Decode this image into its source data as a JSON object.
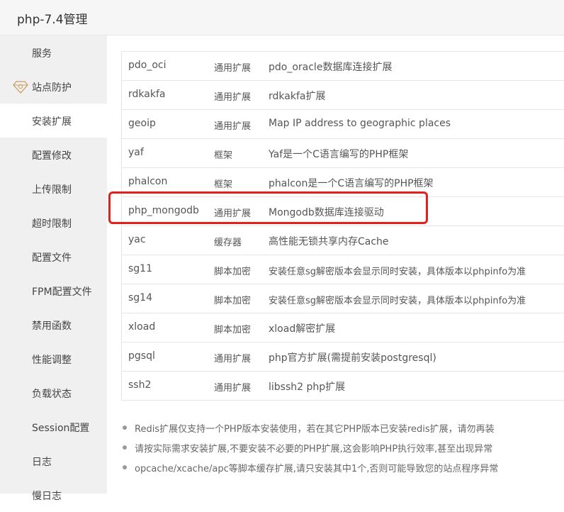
{
  "window": {
    "title": "php-7.4管理"
  },
  "sidebar": {
    "items": [
      {
        "label": "服务"
      },
      {
        "label": "站点防护",
        "icon": "gem-icon"
      },
      {
        "label": "安装扩展",
        "active": true
      },
      {
        "label": "配置修改"
      },
      {
        "label": "上传限制"
      },
      {
        "label": "超时限制"
      },
      {
        "label": "配置文件"
      },
      {
        "label": "FPM配置文件"
      },
      {
        "label": "禁用函数"
      },
      {
        "label": "性能调整"
      },
      {
        "label": "负载状态"
      },
      {
        "label": "Session配置"
      },
      {
        "label": "日志"
      },
      {
        "label": "慢日志"
      }
    ]
  },
  "extensions": {
    "rows": [
      {
        "name": "pdo_oci",
        "type": "通用扩展",
        "desc": "pdo_oracle数据库连接扩展"
      },
      {
        "name": "rdkakfa",
        "type": "通用扩展",
        "desc": "rdkakfa扩展"
      },
      {
        "name": "geoip",
        "type": "通用扩展",
        "desc": "Map IP address to geographic places"
      },
      {
        "name": "yaf",
        "type": "框架",
        "desc": "Yaf是一个C语言编写的PHP框架"
      },
      {
        "name": "phalcon",
        "type": "框架",
        "desc": "phalcon是一个C语言编写的PHP框架"
      },
      {
        "name": "php_mongodb",
        "type": "通用扩展",
        "desc": "Mongodb数据库连接驱动",
        "highlighted": true
      },
      {
        "name": "yac",
        "type": "缓存器",
        "desc": "高性能无锁共享内存Cache"
      },
      {
        "name": "sg11",
        "type": "脚本加密",
        "desc": "安装任意sg解密版本会显示同时安装，具体版本以phpinfo为准"
      },
      {
        "name": "sg14",
        "type": "脚本加密",
        "desc": "安装任意sg解密版本会显示同时安装，具体版本以phpinfo为准"
      },
      {
        "name": "xload",
        "type": "脚本加密",
        "desc": "xload解密扩展"
      },
      {
        "name": "pgsql",
        "type": "通用扩展",
        "desc": "php官方扩展(需提前安装postgresql)"
      },
      {
        "name": "ssh2",
        "type": "通用扩展",
        "desc": "libssh2 php扩展"
      }
    ]
  },
  "notes": [
    "Redis扩展仅支持一个PHP版本安装使用，若在其它PHP版本已安装redis扩展，请勿再装",
    "请按实际需求安装扩展,不要安装不必要的PHP扩展,这会影响PHP执行效率,甚至出现异常",
    "opcache/xcache/apc等脚本缓存扩展,请只安装其中1个,否则可能导致您的站点程序异常"
  ],
  "colors": {
    "highlight": "#e5201b",
    "sidebar_bg": "#f0f0f0",
    "gem": "#c9a062"
  }
}
